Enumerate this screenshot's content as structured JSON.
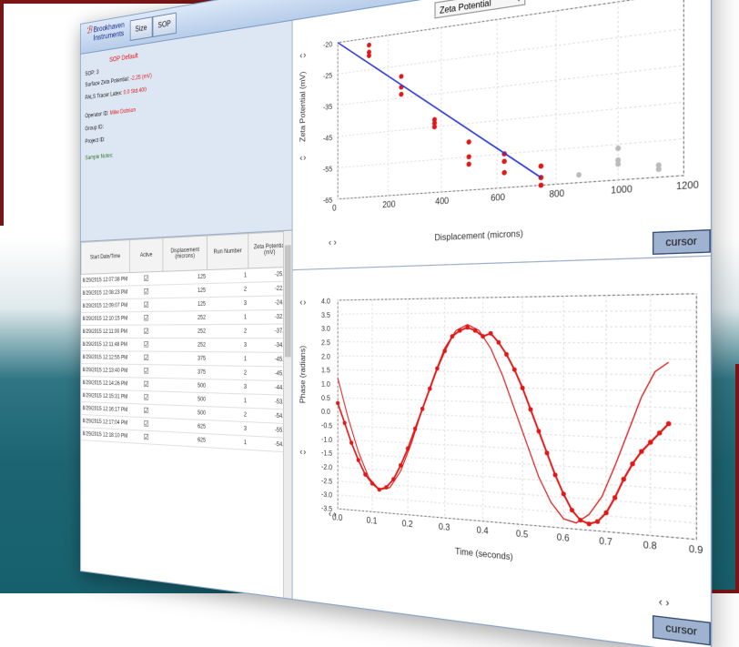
{
  "toolbar": {
    "logo_line1": "Brookhaven",
    "logo_line2": "Instruments",
    "buttons": [
      "Size",
      "SOP"
    ]
  },
  "info": {
    "title": "SOP Default",
    "sop": "SOP: 3",
    "surface_label": "Surface Zeta Potential: ",
    "surface_value": "-2.25 (mV)",
    "tracer_label": "PALS Tracer Latex: ",
    "tracer_value": "0.0 Std.400",
    "operator_label": "Operator ID: ",
    "operator_value": "Mike Dobson",
    "group": "Group ID:",
    "project": "Project ID:",
    "notes": "Sample Notes:"
  },
  "table": {
    "headers": [
      "Start Date/Time",
      "Active",
      "Displacement (microns)",
      "Run Number",
      "Zeta Potential (mV)"
    ],
    "rows": [
      {
        "time": "8/29/2015 12:07:38 PM",
        "active": "☑",
        "disp": "125",
        "run": "1",
        "zeta": "-25.38"
      },
      {
        "time": "8/29/2015 12:08:23 PM",
        "active": "☑",
        "disp": "125",
        "run": "2",
        "zeta": "-22.37"
      },
      {
        "time": "8/29/2015 12:09:07 PM",
        "active": "☑",
        "disp": "125",
        "run": "3",
        "zeta": "-24.27"
      },
      {
        "time": "8/29/2015 12:10:15 PM",
        "active": "☑",
        "disp": "252",
        "run": "1",
        "zeta": "-32.41"
      },
      {
        "time": "8/29/2015 12:11:00 PM",
        "active": "☑",
        "disp": "252",
        "run": "2",
        "zeta": "-37.18"
      },
      {
        "time": "8/29/2015 12:11:48 PM",
        "active": "☑",
        "disp": "252",
        "run": "3",
        "zeta": "-34.78"
      },
      {
        "time": "8/29/2015 12:12:55 PM",
        "active": "☑",
        "disp": "375",
        "run": "1",
        "zeta": "-45.79"
      },
      {
        "time": "8/29/2015 12:13:40 PM",
        "active": "☑",
        "disp": "375",
        "run": "2",
        "zeta": "-45.38"
      },
      {
        "time": "8/29/2015 12:14:26 PM",
        "active": "☑",
        "disp": "500",
        "run": "3",
        "zeta": "-44.45"
      },
      {
        "time": "8/29/2015 12:15:31 PM",
        "active": "☑",
        "disp": "500",
        "run": "1",
        "zeta": "-53.23"
      },
      {
        "time": "8/29/2015 12:16:17 PM",
        "active": "☑",
        "disp": "500",
        "run": "2",
        "zeta": "-54.61"
      },
      {
        "time": "8/29/2015 12:17:04 PM",
        "active": "☑",
        "disp": "625",
        "run": "3",
        "zeta": "-55.16"
      },
      {
        "time": "8/29/2015 12:18:10 PM",
        "active": "☑",
        "disp": "625",
        "run": "1",
        "zeta": "-54.44"
      }
    ]
  },
  "top_chart": {
    "dropdown": "Zeta Potential",
    "ylabel": "Zeta Potential (mV)",
    "xlabel": "Displacement (microns)",
    "xticks": [
      "0",
      "200",
      "400",
      "600",
      "800",
      "1000",
      "1200"
    ],
    "yticks": [
      "-20",
      "-25",
      "-35",
      "-45",
      "-55",
      "-65"
    ],
    "nav": "‹ ›",
    "cursor": "cursor"
  },
  "bottom_chart": {
    "ylabel": "Phase (radians)",
    "xlabel": "Time (seconds)",
    "xticks": [
      "0.0",
      "0.1",
      "0.2",
      "0.3",
      "0.4",
      "0.5",
      "0.6",
      "0.7",
      "0.8",
      "0.9"
    ],
    "yticks": [
      "4.0",
      "3.5",
      "3.0",
      "2.5",
      "2.0",
      "1.5",
      "1.0",
      "0.5",
      "0.0",
      "-0.5",
      "-1.0",
      "-1.5",
      "-2.0",
      "-2.5",
      "-3.0",
      "-3.5"
    ],
    "nav": "‹ ›",
    "cursor": "cursor"
  },
  "chart_data": [
    {
      "type": "scatter",
      "xlabel": "Displacement (microns)",
      "ylabel": "Zeta Potential (mV)",
      "xlim": [
        0,
        1200
      ],
      "ylim": [
        -65,
        -20
      ],
      "series": [
        {
          "color": "#e01818",
          "x": [
            125,
            125,
            125,
            250,
            250,
            250,
            375,
            375,
            375,
            500,
            500,
            500,
            625,
            625,
            625,
            750,
            750,
            750
          ],
          "y": [
            -22,
            -24,
            -25,
            -32,
            -35,
            -37,
            -45,
            -46,
            -47,
            -52,
            -56,
            -58,
            -56,
            -58,
            -61,
            -60,
            -63,
            -65
          ]
        },
        {
          "color": "#bbbbbb",
          "x": [
            875,
            1000,
            1000,
            1000,
            1125,
            1125
          ],
          "y": [
            -63,
            -57,
            -60,
            -61,
            -62,
            -63
          ]
        },
        {
          "type": "line",
          "color": "#2a36d6",
          "x": [
            0,
            750
          ],
          "y": [
            -20,
            -63
          ]
        }
      ]
    },
    {
      "type": "line",
      "xlabel": "Time (seconds)",
      "ylabel": "Phase (radians)",
      "xlim": [
        0,
        0.9
      ],
      "ylim": [
        -3.5,
        4.0
      ],
      "series": [
        {
          "color": "#e01818",
          "marker": "dot",
          "x": [
            0.0,
            0.02,
            0.04,
            0.06,
            0.08,
            0.1,
            0.12,
            0.14,
            0.16,
            0.18,
            0.2,
            0.22,
            0.24,
            0.26,
            0.28,
            0.3,
            0.32,
            0.34,
            0.36,
            0.38,
            0.4,
            0.42,
            0.44,
            0.46,
            0.48,
            0.5,
            0.52,
            0.54,
            0.56,
            0.58,
            0.6,
            0.62,
            0.64,
            0.66,
            0.68,
            0.7,
            0.72,
            0.74,
            0.76,
            0.78,
            0.8,
            0.82,
            0.84
          ],
          "y": [
            0.3,
            -0.4,
            -1.1,
            -1.7,
            -2.2,
            -2.5,
            -2.7,
            -2.6,
            -2.3,
            -1.8,
            -1.2,
            -0.5,
            0.2,
            0.9,
            1.6,
            2.2,
            2.7,
            2.9,
            3.0,
            2.9,
            2.7,
            2.8,
            2.5,
            2.1,
            1.6,
            1.0,
            0.3,
            -0.4,
            -1.1,
            -1.8,
            -2.4,
            -2.9,
            -3.2,
            -3.3,
            -3.2,
            -2.9,
            -2.4,
            -1.8,
            -1.3,
            -0.9,
            -0.6,
            -0.3,
            0.0
          ]
        },
        {
          "color": "#e01818",
          "marker": "none",
          "x": [
            0.0,
            0.03,
            0.06,
            0.09,
            0.12,
            0.15,
            0.18,
            0.21,
            0.24,
            0.27,
            0.3,
            0.33,
            0.36,
            0.39,
            0.42,
            0.45,
            0.48,
            0.51,
            0.54,
            0.57,
            0.6,
            0.63,
            0.66,
            0.69,
            0.72,
            0.75,
            0.78,
            0.81,
            0.84
          ],
          "y": [
            1.2,
            -0.2,
            -1.4,
            -2.3,
            -2.7,
            -2.6,
            -2.0,
            -1.0,
            0.2,
            1.3,
            2.3,
            2.9,
            3.1,
            2.9,
            2.3,
            1.4,
            0.3,
            -0.8,
            -1.9,
            -2.7,
            -3.2,
            -3.3,
            -3.0,
            -2.4,
            -1.4,
            -0.3,
            0.8,
            1.6,
            1.9
          ]
        }
      ]
    }
  ]
}
